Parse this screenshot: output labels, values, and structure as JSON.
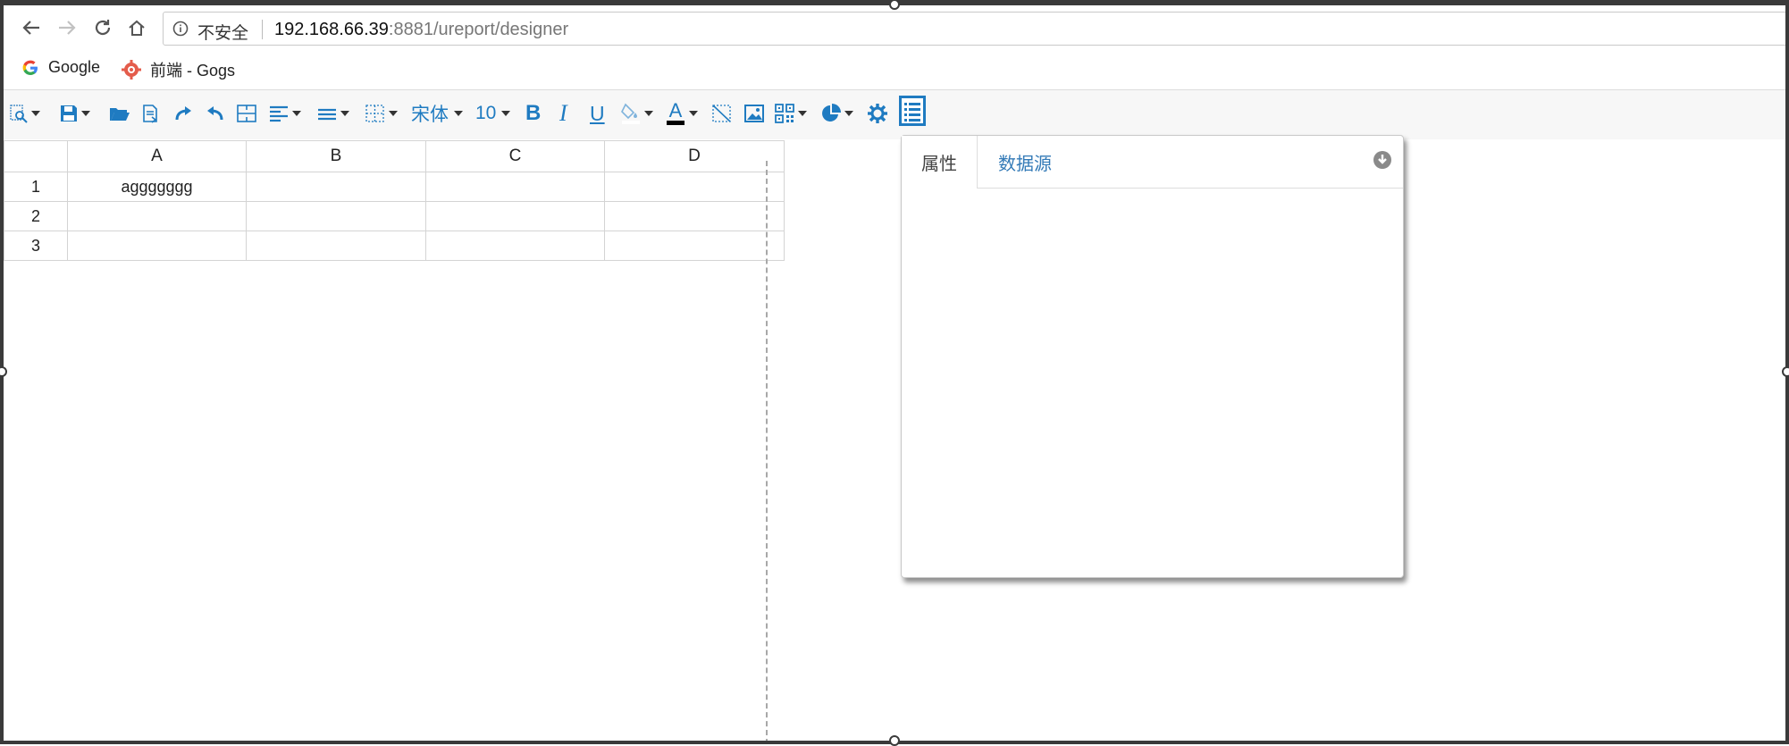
{
  "browser": {
    "security_label": "不安全",
    "url_host": "192.168.66.39",
    "url_rest": ":8881/ureport/designer"
  },
  "bookmarks": [
    {
      "label": "Google",
      "icon": "google-g-icon"
    },
    {
      "label": "前端 - Gogs",
      "icon": "gogs-icon"
    }
  ],
  "toolbar": {
    "font_name": "宋体",
    "font_size": "10",
    "accent_color": "#1f7bc1"
  },
  "sheet": {
    "columns": [
      "A",
      "B",
      "C",
      "D"
    ],
    "rows": [
      {
        "num": "1",
        "cells": [
          "aggggggg",
          "",
          "",
          ""
        ]
      },
      {
        "num": "2",
        "cells": [
          "",
          "",
          "",
          ""
        ]
      },
      {
        "num": "3",
        "cells": [
          "",
          "",
          "",
          ""
        ]
      }
    ]
  },
  "panel": {
    "tabs": [
      "属性",
      "数据源"
    ]
  }
}
